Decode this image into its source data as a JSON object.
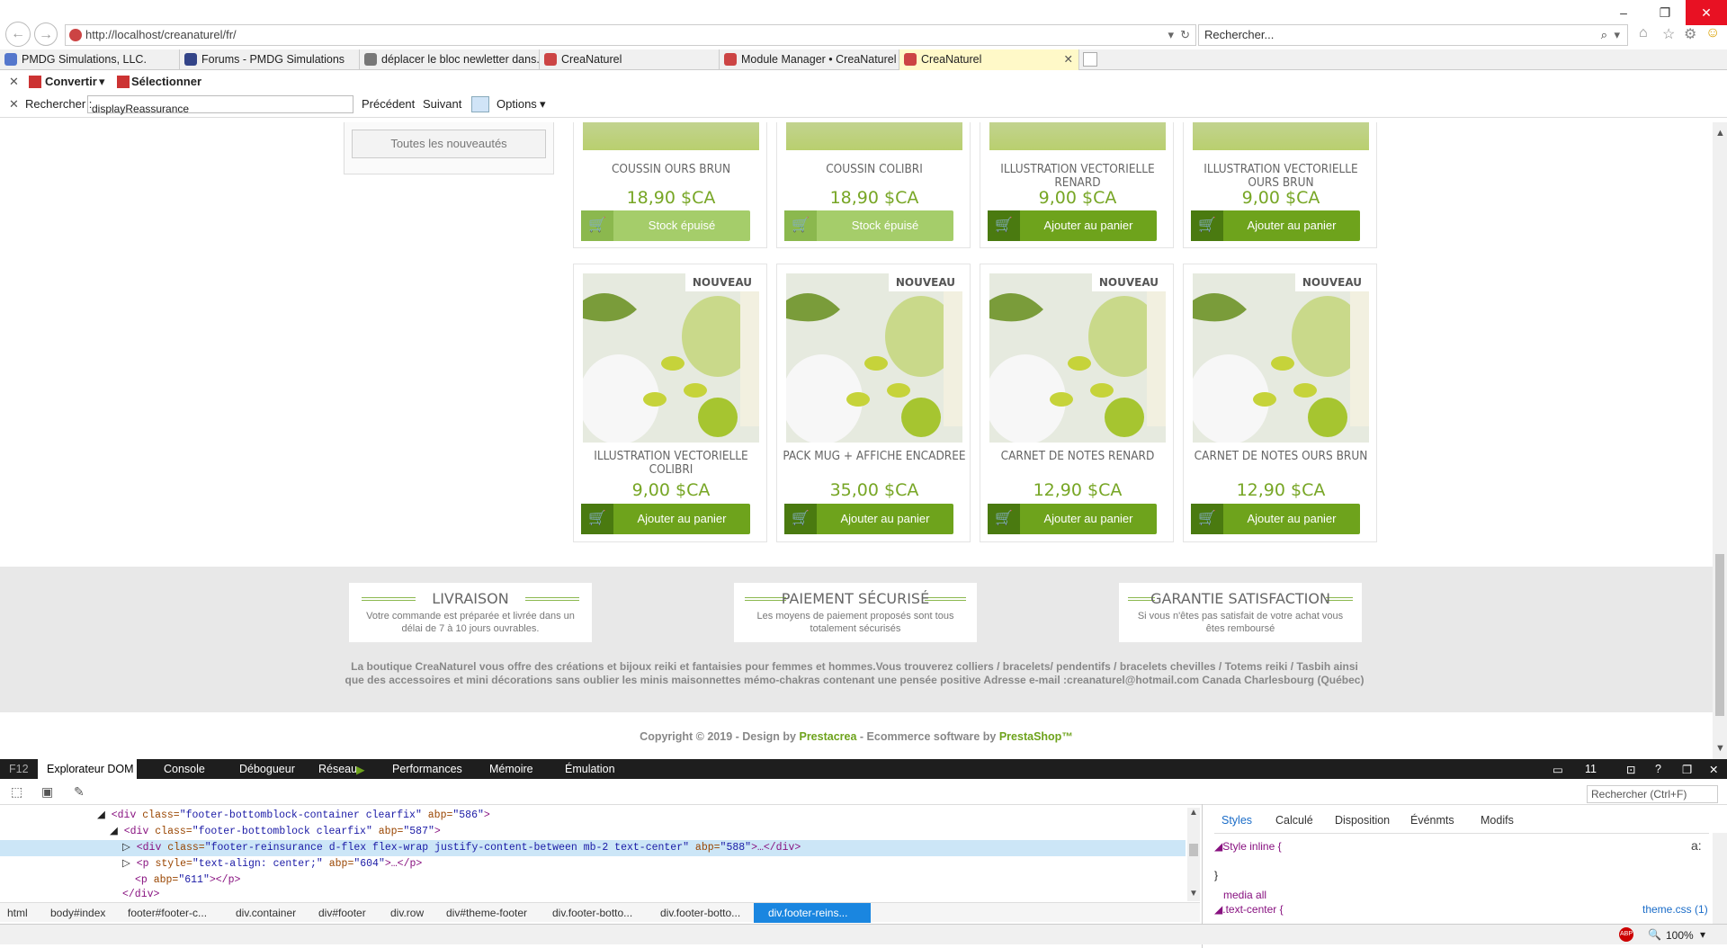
{
  "browser": {
    "url": "http://localhost/creanaturel/fr/",
    "search_placeholder": "Rechercher...",
    "tabs": [
      {
        "label": "PMDG Simulations, LLC.",
        "color": "#d9a6e6"
      },
      {
        "label": "Forums - PMDG Simulations",
        "color": "#d9a6e6"
      },
      {
        "label": "déplacer le bloc newletter dans...",
        "color": "#f0f0f0"
      },
      {
        "label": "CreaNaturel",
        "color": "#f0f0f0"
      },
      {
        "label": "Module Manager • CreaNaturel",
        "color": "#f7efb0"
      },
      {
        "label": "CreaNaturel",
        "color": "#fff9c8"
      }
    ]
  },
  "toolbar": {
    "convert_label": "Convertir",
    "select_label": "Sélectionner",
    "find_label": "Rechercher :",
    "find_value": "displayReassurance",
    "prev_label": "Précédent",
    "next_label": "Suivant",
    "options_label": "Options"
  },
  "page": {
    "all_new_button": "Toutes les nouveautés",
    "badge": "NOUVEAU",
    "products_top": [
      {
        "name": "COUSSIN OURS BRUN",
        "price": "18,90 $CA",
        "action": "Stock épuisé",
        "available": false
      },
      {
        "name": "COUSSIN COLIBRI",
        "price": "18,90 $CA",
        "action": "Stock épuisé",
        "available": false
      },
      {
        "name": "ILLUSTRATION VECTORIELLE RENARD",
        "price": "9,00 $CA",
        "action": "Ajouter au panier",
        "available": true
      },
      {
        "name": "ILLUSTRATION VECTORIELLE OURS BRUN",
        "price": "9,00 $CA",
        "action": "Ajouter au panier",
        "available": true
      }
    ],
    "products_bottom": [
      {
        "name": "ILLUSTRATION VECTORIELLE COLIBRI",
        "price": "9,00 $CA",
        "action": "Ajouter au panier",
        "available": true
      },
      {
        "name": "PACK MUG + AFFICHE ENCADREE",
        "price": "35,00 $CA",
        "action": "Ajouter au panier",
        "available": true
      },
      {
        "name": "CARNET DE NOTES RENARD",
        "price": "12,90 $CA",
        "action": "Ajouter au panier",
        "available": true
      },
      {
        "name": "CARNET DE NOTES OURS BRUN",
        "price": "12,90 $CA",
        "action": "Ajouter au panier",
        "available": true
      }
    ],
    "reassurance": [
      {
        "title": "LIVRAISON",
        "text": "Votre commande est préparée et livrée dans un délai de 7 à 10 jours ouvrables."
      },
      {
        "title": "PAIEMENT SÉCURISÉ",
        "text": "Les moyens de paiement proposés sont tous totalement sécurisés"
      },
      {
        "title": "GARANTIE SATISFACTION",
        "text": "Si vous n'êtes pas satisfait de votre achat vous êtes remboursé"
      }
    ],
    "about_text": "La boutique CreaNaturel vous offre des créations et bijoux reiki et fantaisies pour femmes et hommes.Vous trouverez colliers / bracelets/ pendentifs / bracelets chevilles / Totems reiki / Tasbih ainsi que des accessoires et mini décorations sans oublier les minis maisonnettes mémo-chakras contenant une pensée positive  Adresse e-mail :creanaturel@hotmail.com Canada Charlesbourg (Québec)",
    "copyright_prefix": "Copyright © 2019 - Design by ",
    "copyright_design": "Prestacrea",
    "copyright_mid": " - Ecommerce software by ",
    "copyright_shop": "PrestaShop™"
  },
  "devtools": {
    "f12": "F12",
    "tabs": [
      "Explorateur DOM",
      "Console",
      "Débogueur",
      "Réseau",
      "Performances",
      "Mémoire",
      "Émulation"
    ],
    "doc_mode": "11",
    "find_placeholder": "Rechercher (Ctrl+F)",
    "dom_lines": [
      {
        "indent": 0,
        "arrow": "◢",
        "tag": "div",
        "cls": "footer-bottomblock-container clearfix",
        "abp": "586",
        "tail": ">"
      },
      {
        "indent": 1,
        "arrow": "◢",
        "tag": "div",
        "cls": "footer-bottomblock clearfix",
        "abp": "587",
        "tail": ">"
      },
      {
        "indent": 2,
        "arrow": "▷",
        "tag": "div",
        "cls": "footer-reinsurance d-flex flex-wrap justify-content-between mb-2 text-center",
        "abp": "588",
        "tail": ">…</div>"
      },
      {
        "indent": 2,
        "arrow": "▷",
        "tag": "p",
        "style": "text-align: center;",
        "abp": "604",
        "tail": ">…</p>"
      },
      {
        "indent": 2,
        "arrow": "",
        "tag": "p",
        "abp": "611",
        "tail": "></p>"
      },
      {
        "indent": 1,
        "arrow": "",
        "close": "</div>"
      }
    ],
    "style_tabs": [
      "Styles",
      "Calculé",
      "Disposition",
      "Événmts",
      "Modifs"
    ],
    "style_inline": "Style inline  {",
    "style_close": "}",
    "media": "media all",
    "selector": "text-center  {",
    "source": "theme.css (1)",
    "breadcrumbs": [
      "html",
      "body#index",
      "footer#footer-c...",
      "div.container",
      "div#footer",
      "div.row",
      "div#theme-footer",
      "div.footer-botto...",
      "div.footer-botto...",
      "div.footer-reins..."
    ]
  },
  "status": {
    "zoom": "100%"
  },
  "colors": {
    "accent": "#77a625",
    "button": "#6ea31c",
    "disabled": "#a5cd6a"
  }
}
